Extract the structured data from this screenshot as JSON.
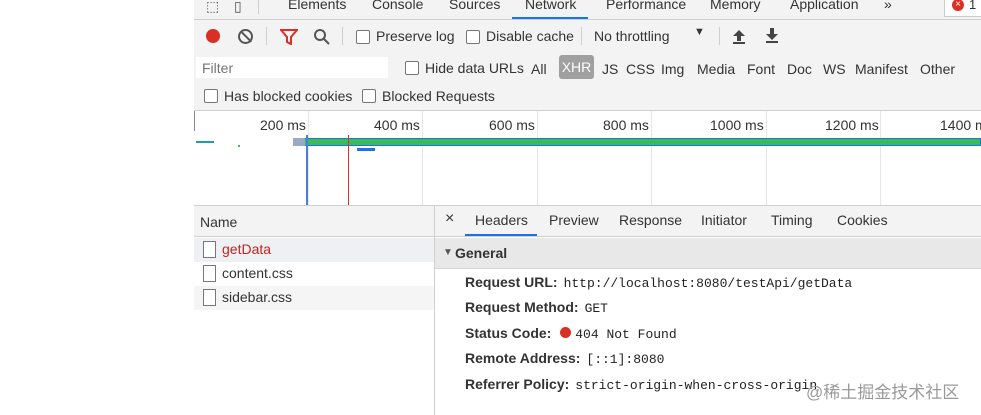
{
  "tabs": {
    "items": [
      "Elements",
      "Console",
      "Sources",
      "Network",
      "Performance",
      "Memory",
      "Application"
    ],
    "more": "»",
    "error_count": "1"
  },
  "toolbar": {
    "preserve_log": "Preserve log",
    "disable_cache": "Disable cache",
    "throttling": "No throttling"
  },
  "filter": {
    "placeholder": "Filter",
    "hide_data_urls": "Hide data URLs",
    "types": [
      "All",
      "XHR",
      "JS",
      "CSS",
      "Img",
      "Media",
      "Font",
      "Doc",
      "WS",
      "Manifest",
      "Other"
    ],
    "has_blocked_cookies": "Has blocked cookies",
    "blocked_requests": "Blocked Requests"
  },
  "timeline": {
    "ticks": [
      "200 ms",
      "400 ms",
      "600 ms",
      "800 ms",
      "1000 ms",
      "1200 ms",
      "1400 m"
    ]
  },
  "requests": {
    "header": "Name",
    "items": [
      "getData",
      "content.css",
      "sidebar.css"
    ]
  },
  "details": {
    "close": "×",
    "tabs": [
      "Headers",
      "Preview",
      "Response",
      "Initiator",
      "Timing",
      "Cookies"
    ],
    "general_title": "General",
    "request_url_label": "Request URL:",
    "request_url": "http://localhost:8080/testApi/getData",
    "request_method_label": "Request Method:",
    "request_method": "GET",
    "status_code_label": "Status Code:",
    "status_code": "404 Not Found",
    "remote_address_label": "Remote Address:",
    "remote_address": "[::1]:8080",
    "referrer_policy_label": "Referrer Policy:",
    "referrer_policy": "strict-origin-when-cross-origin"
  },
  "watermark": "@稀土掘金技术社区",
  "colors": {
    "record": "#d93025",
    "accent": "#1a73e8",
    "error_text": "#c5221f",
    "waterfall": "#3cba54"
  }
}
